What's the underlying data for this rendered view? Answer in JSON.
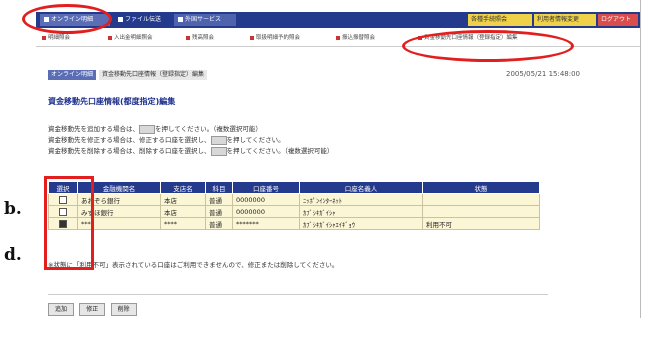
{
  "header": {
    "tabs": [
      {
        "label": "オンライン明細"
      },
      {
        "label": "ファイル伝送"
      },
      {
        "label": "外国サービス"
      }
    ],
    "right_tabs": [
      {
        "label": "各種手続照会"
      },
      {
        "label": "利用者情報変更"
      },
      {
        "label": "ログアウト"
      }
    ]
  },
  "subnav": {
    "items": [
      {
        "label": "明細照会"
      },
      {
        "label": "入出金明細照会"
      },
      {
        "label": "残高照会"
      },
      {
        "label": "取扱明細予約照会"
      },
      {
        "label": "振込振替照会"
      },
      {
        "label": "資金移動先口座情報（登録指定）編集"
      }
    ]
  },
  "breadcrumb": {
    "section": "オンライン明細",
    "page": "資金移動先口座情報（登録指定）編集"
  },
  "datetime": "2005/05/21 15:48:00",
  "page_title": "資金移動先口座情報(都度指定)編集",
  "instructions": {
    "line1_a": "資金移動先を追加する場合は、",
    "line1_b": "を押してください。（複数選択可能）",
    "line2_a": "資金移動先を修正する場合は、修正する口座を選択し、",
    "line2_b": "を押してください。",
    "line3_a": "資金移動先を削除する場合は、削除する口座を選択し、",
    "line3_b": "を押してください。（複数選択可能）"
  },
  "table": {
    "headers": [
      "選択",
      "金融機関名",
      "支店名",
      "科目",
      "口座番号",
      "口座名義人",
      "状態"
    ],
    "rows": [
      {
        "label": "b.",
        "checked": false,
        "bank": "あおぞら銀行",
        "branch": "本店",
        "type": "普通",
        "number": "0000000",
        "holder": "ﾆｯﾎﾟﾝｲﾝﾀｰﾈｯﾄ",
        "status": ""
      },
      {
        "label": "",
        "checked": false,
        "bank": "みずほ銀行",
        "branch": "本店",
        "type": "普通",
        "number": "0000000",
        "holder": "ｶﾌﾞｼｷｶﾞｲｼｬ",
        "status": ""
      },
      {
        "label": "d.",
        "checked": true,
        "bank": "****",
        "branch": "****",
        "type": "普通",
        "number": "*******",
        "holder": "ｶﾌﾞｼｷｶﾞｲｼｬｴｲｷﾞｮｳ",
        "status": "利用不可"
      }
    ]
  },
  "note": "※状態に「利用不可」表示されている口座はご利用できませんので、修正または削除してください。",
  "buttons": {
    "add": "追加",
    "edit": "修正",
    "delete": "削除"
  },
  "colors": {
    "header_bg": "#243a8c",
    "row_bg": "#fbf6d6",
    "highlight": "#e21e1e"
  }
}
